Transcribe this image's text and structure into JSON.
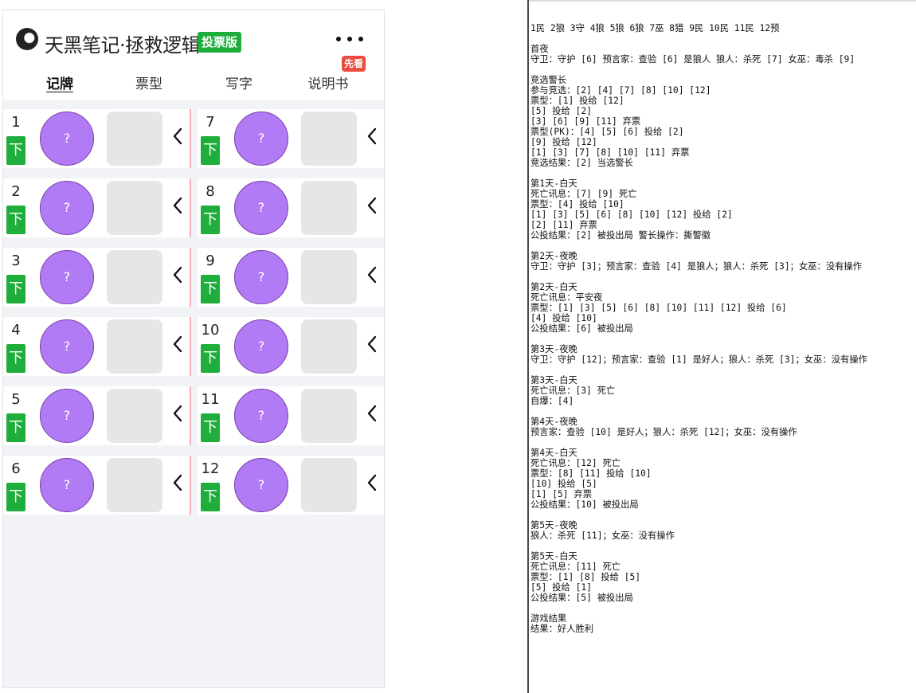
{
  "app": {
    "title": "天黑笔记·拯救逻辑",
    "edition_badge": "投票版",
    "xiankan_badge": "先看",
    "tabs": [
      "记牌",
      "票型",
      "写字",
      "说明书"
    ]
  },
  "players": [
    {
      "number": "1",
      "down_label": "下",
      "avatar_text": "?"
    },
    {
      "number": "2",
      "down_label": "下",
      "avatar_text": "?"
    },
    {
      "number": "3",
      "down_label": "下",
      "avatar_text": "?"
    },
    {
      "number": "4",
      "down_label": "下",
      "avatar_text": "?"
    },
    {
      "number": "5",
      "down_label": "下",
      "avatar_text": "?"
    },
    {
      "number": "6",
      "down_label": "下",
      "avatar_text": "?"
    },
    {
      "number": "7",
      "down_label": "下",
      "avatar_text": "?"
    },
    {
      "number": "8",
      "down_label": "下",
      "avatar_text": "?"
    },
    {
      "number": "9",
      "down_label": "下",
      "avatar_text": "?"
    },
    {
      "number": "10",
      "down_label": "下",
      "avatar_text": "?"
    },
    {
      "number": "11",
      "down_label": "下",
      "avatar_text": "?"
    },
    {
      "number": "12",
      "down_label": "下",
      "avatar_text": "?"
    }
  ],
  "colors": {
    "accent_green": "#1dad3a",
    "avatar_purple": "#b07bf5",
    "badge_red": "#ee4b3e"
  },
  "log_lines": [
    "1民 2狼 3守 4狼 5狼 6狼 7巫 8猎 9民 10民 11民 12预",
    "",
    "首夜",
    "守卫：守护 [6] 预言家：查验 [6] 是狼人 狼人：杀死 [7] 女巫：毒杀 [9]",
    "",
    "竞选警长",
    "参与竞选：[2] [4] [7] [8] [10] [12]",
    "票型：[1] 投给 [12]",
    "[5] 投给 [2]",
    "[3] [6] [9] [11] 弃票",
    "票型(PK)：[4] [5] [6] 投给 [2]",
    "[9] 投给 [12]",
    "[1] [3] [7] [8] [10] [11] 弃票",
    "竞选结果：[2] 当选警长",
    "",
    "第1天-白天",
    "死亡讯息：[7] [9] 死亡",
    "票型：[4] 投给 [10]",
    "[1] [3] [5] [6] [8] [10] [12] 投给 [2]",
    "[2] [11] 弃票",
    "公投结果：[2] 被投出局 警长操作：撕警徽",
    "",
    "第2天-夜晚",
    "守卫：守护 [3]；预言家：查验 [4] 是狼人；狼人：杀死 [3]；女巫：没有操作",
    "",
    "第2天-白天",
    "死亡讯息：平安夜",
    "票型：[1] [3] [5] [6] [8] [10] [11] [12] 投给 [6]",
    "[4] 投给 [10]",
    "公投结果：[6] 被投出局",
    "",
    "第3天-夜晚",
    "守卫：守护 [12]；预言家：查验 [1] 是好人；狼人：杀死 [3]；女巫：没有操作",
    "",
    "第3天-白天",
    "死亡讯息：[3] 死亡",
    "自爆：[4]",
    "",
    "第4天-夜晚",
    "预言家：查验 [10] 是好人；狼人：杀死 [12]；女巫：没有操作",
    "",
    "第4天-白天",
    "死亡讯息：[12] 死亡",
    "票型：[8] [11] 投给 [10]",
    "[10] 投给 [5]",
    "[1] [5] 弃票",
    "公投结果：[10] 被投出局",
    "",
    "第5天-夜晚",
    "狼人：杀死 [11]；女巫：没有操作",
    "",
    "第5天-白天",
    "死亡讯息：[11] 死亡",
    "票型：[1] [8] 投给 [5]",
    "[5] 投给 [1]",
    "公投结果：[5] 被投出局",
    "",
    "游戏结果",
    "结果：好人胜利"
  ]
}
